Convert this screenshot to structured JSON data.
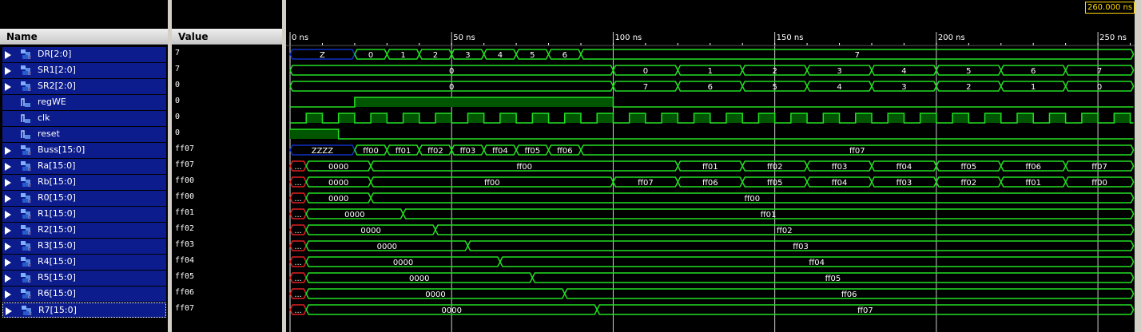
{
  "headers": {
    "name": "Name",
    "value": "Value"
  },
  "cursor_time": "260.000 ns",
  "time_ticks": [
    {
      "t": 0,
      "label": "0 ns"
    },
    {
      "t": 50,
      "label": "50 ns"
    },
    {
      "t": 100,
      "label": "100 ns"
    },
    {
      "t": 150,
      "label": "150 ns"
    },
    {
      "t": 200,
      "label": "200 ns"
    },
    {
      "t": 250,
      "label": "250 ns"
    }
  ],
  "time_end_ns": 261,
  "colors": {
    "wave": "#22e022",
    "undef": "#1030c0",
    "unknown": "#e02020",
    "grid": "#ffffff",
    "high_fill": "#005500"
  },
  "signals": [
    {
      "name": "DR[2:0]",
      "value": "7",
      "kind": "bus",
      "segments": [
        [
          0,
          20,
          "Z",
          "z"
        ],
        [
          20,
          30,
          "0"
        ],
        [
          30,
          40,
          "1"
        ],
        [
          40,
          50,
          "2"
        ],
        [
          50,
          60,
          "3"
        ],
        [
          60,
          70,
          "4"
        ],
        [
          70,
          80,
          "5"
        ],
        [
          80,
          90,
          "6"
        ],
        [
          90,
          261,
          "7"
        ]
      ]
    },
    {
      "name": "SR1[2:0]",
      "value": "7",
      "kind": "bus",
      "segments": [
        [
          0,
          100,
          "0"
        ],
        [
          100,
          120,
          "0"
        ],
        [
          120,
          140,
          "1"
        ],
        [
          140,
          160,
          "2"
        ],
        [
          160,
          180,
          "3"
        ],
        [
          180,
          200,
          "4"
        ],
        [
          200,
          220,
          "5"
        ],
        [
          220,
          240,
          "6"
        ],
        [
          240,
          261,
          "7"
        ]
      ]
    },
    {
      "name": "SR2[2:0]",
      "value": "0",
      "kind": "bus",
      "segments": [
        [
          0,
          100,
          "0"
        ],
        [
          100,
          120,
          "7"
        ],
        [
          120,
          140,
          "6"
        ],
        [
          140,
          160,
          "5"
        ],
        [
          160,
          180,
          "4"
        ],
        [
          180,
          200,
          "3"
        ],
        [
          200,
          220,
          "2"
        ],
        [
          220,
          240,
          "1"
        ],
        [
          240,
          261,
          "0"
        ]
      ]
    },
    {
      "name": "regWE",
      "value": "0",
      "kind": "bit",
      "edges": [
        [
          0,
          0
        ],
        [
          20,
          1
        ],
        [
          100,
          0
        ]
      ]
    },
    {
      "name": "clk",
      "value": "0",
      "kind": "clock",
      "period": 10,
      "first_rise": 5
    },
    {
      "name": "reset",
      "value": "0",
      "kind": "bit",
      "edges": [
        [
          0,
          1
        ],
        [
          15,
          0
        ]
      ]
    },
    {
      "name": "Buss[15:0]",
      "value": "ff07",
      "kind": "bus",
      "segments": [
        [
          0,
          20,
          "ZZZZ",
          "z"
        ],
        [
          20,
          30,
          "ff00"
        ],
        [
          30,
          40,
          "ff01"
        ],
        [
          40,
          50,
          "ff02"
        ],
        [
          50,
          60,
          "ff03"
        ],
        [
          60,
          70,
          "ff04"
        ],
        [
          70,
          80,
          "ff05"
        ],
        [
          80,
          90,
          "ff06"
        ],
        [
          90,
          261,
          "ff07"
        ]
      ]
    },
    {
      "name": "Ra[15:0]",
      "value": "ff07",
      "kind": "bus",
      "segments": [
        [
          0,
          5,
          "...",
          "x"
        ],
        [
          5,
          25,
          "0000"
        ],
        [
          25,
          120,
          "ff00"
        ],
        [
          120,
          140,
          "ff01"
        ],
        [
          140,
          160,
          "ff02"
        ],
        [
          160,
          180,
          "ff03"
        ],
        [
          180,
          200,
          "ff04"
        ],
        [
          200,
          220,
          "ff05"
        ],
        [
          220,
          240,
          "ff06"
        ],
        [
          240,
          261,
          "ff07"
        ]
      ]
    },
    {
      "name": "Rb[15:0]",
      "value": "ff00",
      "kind": "bus",
      "segments": [
        [
          0,
          5,
          "...",
          "x"
        ],
        [
          5,
          25,
          "0000"
        ],
        [
          25,
          100,
          "ff00"
        ],
        [
          100,
          120,
          "ff07"
        ],
        [
          120,
          140,
          "ff06"
        ],
        [
          140,
          160,
          "ff05"
        ],
        [
          160,
          180,
          "ff04"
        ],
        [
          180,
          200,
          "ff03"
        ],
        [
          200,
          220,
          "ff02"
        ],
        [
          220,
          240,
          "ff01"
        ],
        [
          240,
          261,
          "ff00"
        ]
      ]
    },
    {
      "name": "R0[15:0]",
      "value": "ff00",
      "kind": "bus",
      "segments": [
        [
          0,
          5,
          "...",
          "x"
        ],
        [
          5,
          25,
          "0000"
        ],
        [
          25,
          261,
          "ff00"
        ]
      ]
    },
    {
      "name": "R1[15:0]",
      "value": "ff01",
      "kind": "bus",
      "segments": [
        [
          0,
          5,
          "...",
          "x"
        ],
        [
          5,
          35,
          "0000"
        ],
        [
          35,
          261,
          "ff01"
        ]
      ]
    },
    {
      "name": "R2[15:0]",
      "value": "ff02",
      "kind": "bus",
      "segments": [
        [
          0,
          5,
          "...",
          "x"
        ],
        [
          5,
          45,
          "0000"
        ],
        [
          45,
          261,
          "ff02"
        ]
      ]
    },
    {
      "name": "R3[15:0]",
      "value": "ff03",
      "kind": "bus",
      "segments": [
        [
          0,
          5,
          "...",
          "x"
        ],
        [
          5,
          55,
          "0000"
        ],
        [
          55,
          261,
          "ff03"
        ]
      ]
    },
    {
      "name": "R4[15:0]",
      "value": "ff04",
      "kind": "bus",
      "segments": [
        [
          0,
          5,
          "...",
          "x"
        ],
        [
          5,
          65,
          "0000"
        ],
        [
          65,
          261,
          "ff04"
        ]
      ]
    },
    {
      "name": "R5[15:0]",
      "value": "ff05",
      "kind": "bus",
      "segments": [
        [
          0,
          5,
          "...",
          "x"
        ],
        [
          5,
          75,
          "0000"
        ],
        [
          75,
          261,
          "ff05"
        ]
      ]
    },
    {
      "name": "R6[15:0]",
      "value": "ff06",
      "kind": "bus",
      "segments": [
        [
          0,
          5,
          "...",
          "x"
        ],
        [
          5,
          85,
          "0000"
        ],
        [
          85,
          261,
          "ff06"
        ]
      ]
    },
    {
      "name": "R7[15:0]",
      "value": "ff07",
      "kind": "bus",
      "segments": [
        [
          0,
          5,
          "...",
          "x"
        ],
        [
          5,
          95,
          "0000"
        ],
        [
          95,
          261,
          "ff07"
        ]
      ]
    }
  ]
}
